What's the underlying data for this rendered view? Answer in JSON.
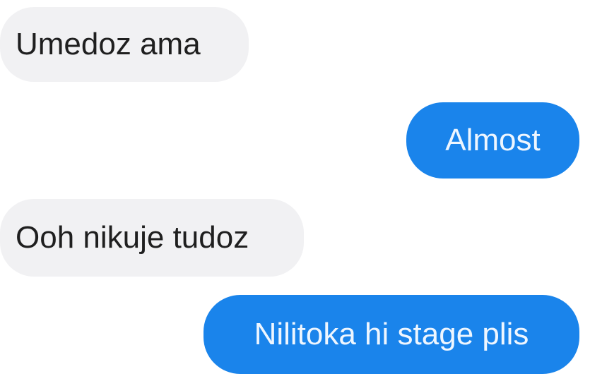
{
  "conversation": {
    "messages": [
      {
        "direction": "incoming",
        "text": "Umedoz ama"
      },
      {
        "direction": "outgoing",
        "text": "Almost"
      },
      {
        "direction": "incoming",
        "text": "Ooh nikuje tudoz"
      },
      {
        "direction": "outgoing",
        "text": "Nilitoka hi stage plis"
      }
    ]
  },
  "colors": {
    "incoming_bubble": "#f1f1f3",
    "incoming_text": "#1f1f1f",
    "outgoing_bubble": "#1a84eb",
    "outgoing_text": "#eef6ff",
    "background": "#ffffff"
  }
}
